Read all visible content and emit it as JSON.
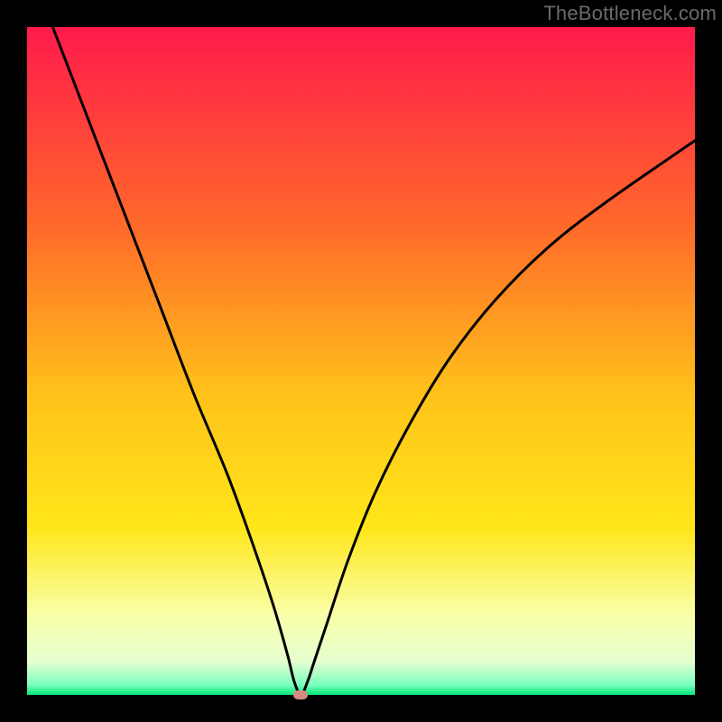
{
  "watermark": "TheBottleneck.com",
  "colors": {
    "frame": "#000000",
    "watermark": "#6a6a6a",
    "curve": "#000000",
    "marker": "#d58a82",
    "gradient_stops": [
      {
        "offset": 0.0,
        "color": "#ff1a4b"
      },
      {
        "offset": 0.3,
        "color": "#ff6a2a"
      },
      {
        "offset": 0.55,
        "color": "#ffc21a"
      },
      {
        "offset": 0.75,
        "color": "#ffe61a"
      },
      {
        "offset": 0.88,
        "color": "#f9ffa8"
      },
      {
        "offset": 0.95,
        "color": "#e6ffd0"
      },
      {
        "offset": 0.985,
        "color": "#7affc0"
      },
      {
        "offset": 1.0,
        "color": "#00e676"
      }
    ]
  },
  "chart_data": {
    "type": "line",
    "title": "",
    "xlabel": "",
    "ylabel": "",
    "xlim": [
      0,
      100
    ],
    "ylim": [
      0,
      100
    ],
    "minimum_at_x_pct": 41,
    "marker": {
      "x_pct": 41,
      "y_pct": 0
    },
    "series": [
      {
        "name": "bottleneck-curve",
        "x": [
          0,
          5,
          10,
          15,
          20,
          25,
          30,
          34,
          37,
          39,
          40,
          41,
          42,
          43,
          45,
          48,
          52,
          57,
          63,
          70,
          78,
          87,
          100
        ],
        "y": [
          110,
          97,
          84,
          71,
          58,
          45,
          33,
          22,
          13,
          6,
          2,
          0,
          2,
          5,
          11,
          20,
          30,
          40,
          50,
          59,
          67,
          74,
          83
        ]
      }
    ]
  }
}
